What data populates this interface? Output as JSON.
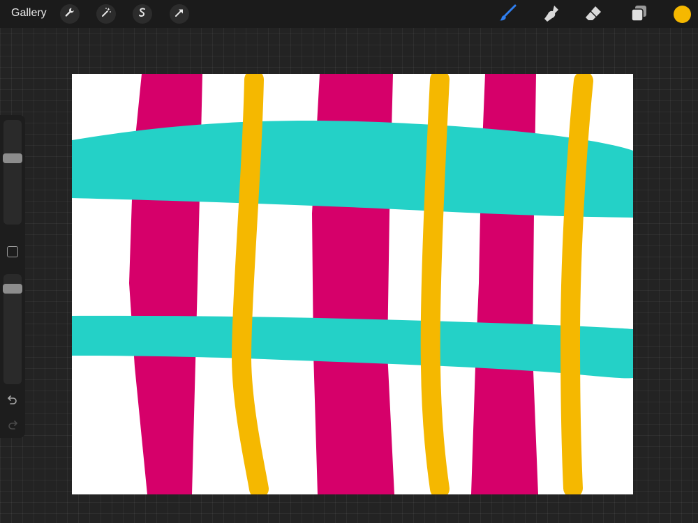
{
  "topbar": {
    "gallery_label": "Gallery",
    "left_tools": [
      "wrench-icon",
      "magic-wand-icon",
      "selection-icon",
      "transform-arrow-icon"
    ],
    "right_tools": [
      "brush-icon",
      "smudge-icon",
      "eraser-icon",
      "layers-icon"
    ],
    "active_tool": "brush",
    "current_color": "#f5b800"
  },
  "sidebar": {
    "brush_size_level": 0.35,
    "opacity_level": 0.1,
    "buttons": [
      "modify-square-icon",
      "undo-icon",
      "redo-icon"
    ]
  },
  "artwork": {
    "background": "#ffffff",
    "colors": {
      "magenta": "#d6006a",
      "cyan": "#24d1c7",
      "yellow": "#f5b800"
    }
  }
}
